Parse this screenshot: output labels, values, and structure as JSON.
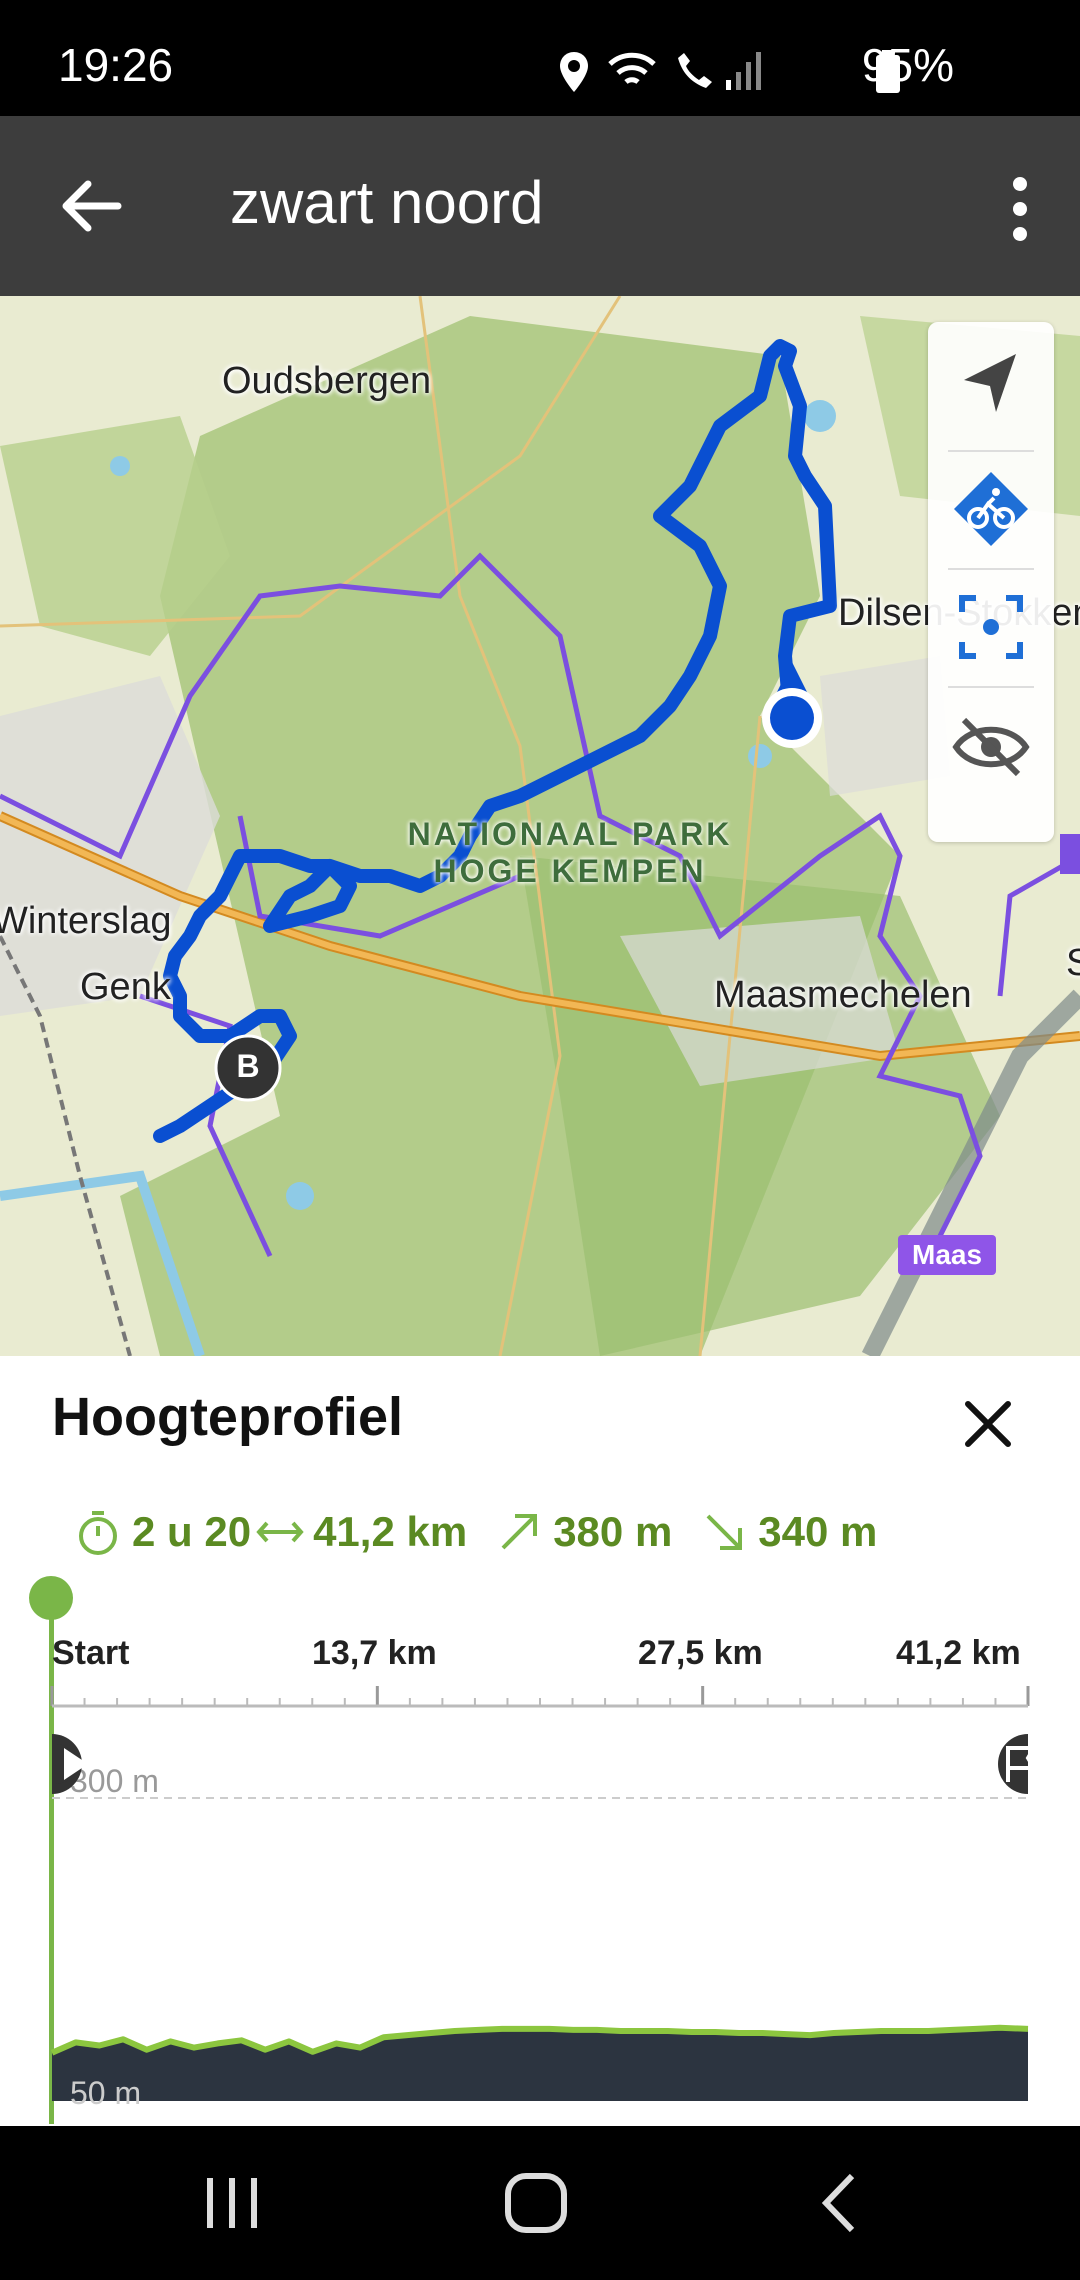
{
  "status": {
    "time": "19:26",
    "battery": "95%"
  },
  "appbar": {
    "title": "zwart noord",
    "back_icon": "arrow-left-icon",
    "more_icon": "more-vert-icon"
  },
  "map": {
    "labels": {
      "oudsbergen": "Oudsbergen",
      "dilsen": "Dilsen-Stokkem",
      "winterslag": "Winterslag",
      "genk": "Genk",
      "maasmechelen": "Maasmechelen",
      "park_line1": "NATIONAAL PARK",
      "park_line2": "HOGE KEMPEN",
      "maas": "Maas",
      "end_marker": "B",
      "edge_s": "S"
    },
    "controls": [
      "navigation-arrow-icon",
      "bike-route-icon",
      "focus-route-icon",
      "hide-icon"
    ],
    "colors": {
      "route": "#0a4fd1",
      "cycle_network": "#7b4fe0",
      "highway": "#f0a830",
      "forest": "#a9c77e",
      "land": "#e9ebd1"
    }
  },
  "panel": {
    "title": "Hoogteprofiel",
    "close_icon": "close-icon",
    "stats": {
      "duration": "2 u 20",
      "distance": "41,2 km",
      "ascent": "380 m",
      "descent": "340 m"
    },
    "axis": {
      "start": "Start",
      "t1": "13,7 km",
      "t2": "27,5 km",
      "end": "41,2 km"
    },
    "y_top": "300 m",
    "y_bottom": "50 m",
    "colors": {
      "accent": "#7ab648",
      "text_green": "#5b8a22",
      "profile_fill": "#2c3440"
    }
  },
  "chart_data": {
    "type": "area",
    "title": "",
    "xlabel": "",
    "ylabel": "",
    "xlim": [
      0,
      41.2
    ],
    "ylim": [
      50,
      300
    ],
    "x": [
      0,
      1,
      2,
      3,
      4,
      5,
      6,
      7,
      8,
      9,
      10,
      11,
      12,
      13,
      14,
      15,
      16,
      17,
      18,
      19,
      20,
      21,
      22,
      23,
      24,
      25,
      26,
      27,
      28,
      29,
      30,
      31,
      32,
      33,
      34,
      35,
      36,
      37,
      38,
      39,
      40,
      41.2
    ],
    "values": [
      55,
      65,
      62,
      68,
      58,
      66,
      60,
      64,
      67,
      58,
      66,
      56,
      64,
      60,
      70,
      72,
      74,
      76,
      77,
      78,
      78,
      78,
      77,
      77,
      76,
      76,
      76,
      75,
      75,
      74,
      74,
      73,
      72,
      74,
      75,
      76,
      76,
      76,
      77,
      78,
      79,
      78
    ]
  }
}
